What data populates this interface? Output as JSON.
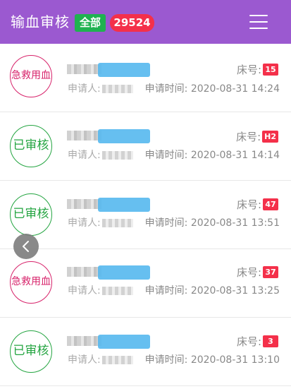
{
  "header": {
    "title": "输血审核",
    "filter_label": "全部",
    "total_count": "29524",
    "menu_icon": "hamburger-menu-icon",
    "background_color": "#9b59d0"
  },
  "labels": {
    "bed": "床号:",
    "applicant": "申请人:",
    "request_time": "申请时间:"
  },
  "status_colors": {
    "urgent": "#d7226a",
    "approved": "#25a542",
    "bed_badge": "#f4304a"
  },
  "records": [
    {
      "status": "急救用血",
      "status_type": "urgent",
      "bed": "15",
      "time": "2020-08-31 14:24"
    },
    {
      "status": "已审核",
      "status_type": "approved",
      "bed": "H2",
      "time": "2020-08-31 14:14"
    },
    {
      "status": "已审核",
      "status_type": "approved",
      "bed": "47",
      "time": "2020-08-31 13:51"
    },
    {
      "status": "急救用血",
      "status_type": "urgent",
      "bed": "37",
      "time": "2020-08-31 13:25"
    },
    {
      "status": "已审核",
      "status_type": "approved",
      "bed": "3",
      "time": "2020-08-31 13:10"
    }
  ],
  "back_button_icon": "chevron-left-icon"
}
